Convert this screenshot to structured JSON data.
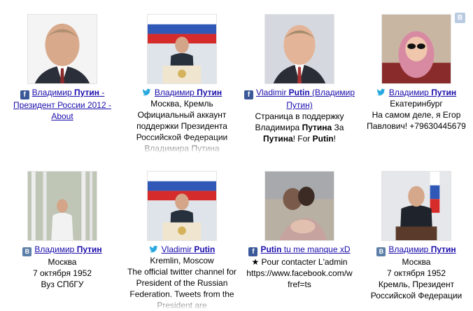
{
  "corner_badge": "B",
  "row1": [
    {
      "network": "facebook",
      "name_pre": "Владимир ",
      "name_bold": "Путин",
      "name_post": " - Президент России 2012 - About",
      "desc": ""
    },
    {
      "network": "twitter",
      "name_pre": "Владимир ",
      "name_bold": "Путин",
      "name_post": "",
      "desc": "Москва, Кремль\nОфициальный аккаунт поддержки Президента Российской Федерации\nВладимира Путина"
    },
    {
      "network": "facebook",
      "name_pre": "Vladimir ",
      "name_bold": "Putin",
      "name_post": " (Владимир Путин)",
      "desc_parts": [
        "Страница в поддержку Владимира ",
        "Путина",
        " За ",
        "Путина",
        "! For ",
        "Putin",
        "!"
      ]
    },
    {
      "network": "twitter",
      "name_pre": "Владимир ",
      "name_bold": "Путин",
      "name_post": "",
      "desc": "Екатеринбург\nНа самом деле, я Егор Павлович! +79630445679"
    }
  ],
  "row2": [
    {
      "network": "vk",
      "name_pre": "Владимир ",
      "name_bold": "Путин",
      "name_post": "",
      "desc": "Москва\n7 октября 1952\nВуз СПбГУ"
    },
    {
      "network": "twitter",
      "name_pre": "Vladimir ",
      "name_bold": "Putin",
      "name_post": "",
      "desc": "Kremlin, Moscow\nThe official twitter channel for President of the Russian Federation. Tweets from the President are"
    },
    {
      "network": "facebook",
      "name_pre": "",
      "name_bold": "Putin",
      "name_post": " tu me manque xD",
      "desc": "★ Pour contacter L'admin\nhttps://www.facebook.com/w\nfref=ts"
    },
    {
      "network": "vk",
      "name_pre": "Владимир ",
      "name_bold": "Путин",
      "name_post": "",
      "desc": "Москва\n7 октября 1952\nКремль, Президент Российской Федерации"
    }
  ],
  "icons": {
    "facebook": "f",
    "vk": "В"
  }
}
